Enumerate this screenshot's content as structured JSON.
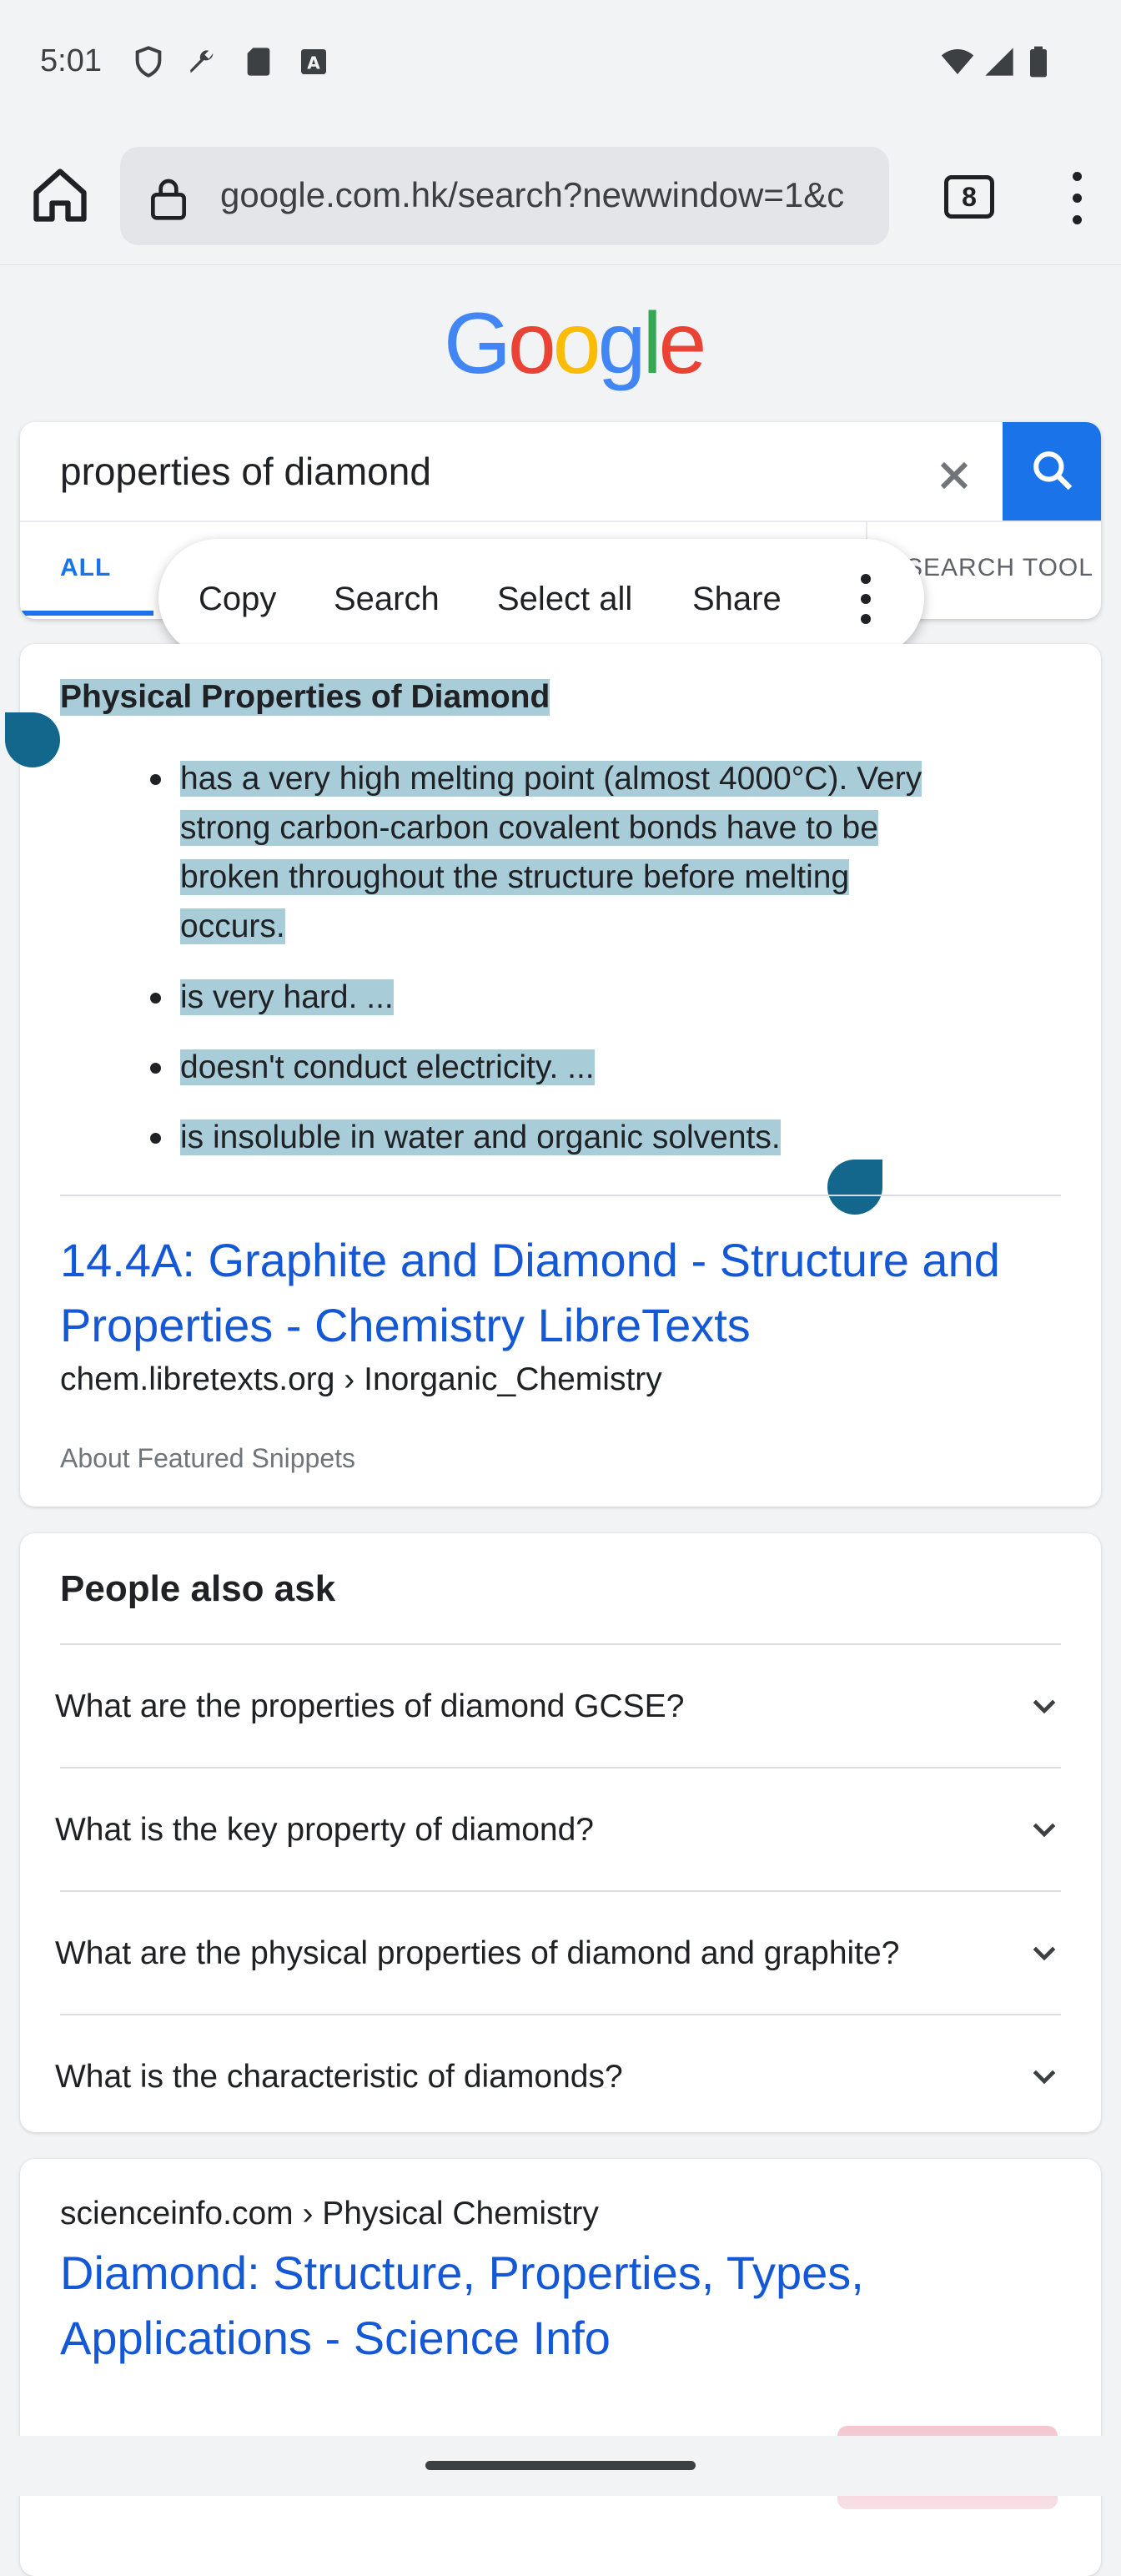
{
  "status_bar": {
    "time": "5:01"
  },
  "browser": {
    "url": "google.com.hk/search?newwindow=1&c",
    "tab_count": "8"
  },
  "logo": {
    "text": "Google"
  },
  "search": {
    "query": "properties of diamond",
    "tabs": {
      "all": "ALL",
      "tools": "SEARCH TOOL"
    }
  },
  "context_menu": {
    "copy": "Copy",
    "search": "Search",
    "select_all": "Select all",
    "share": "Share"
  },
  "snippet": {
    "heading": "Physical Properties of Diamond",
    "bullets": [
      [
        "has a very high melting point (almost 4000°C). Very",
        "strong carbon-carbon covalent bonds have to be",
        "broken throughout the structure before melting",
        "occurs."
      ],
      "is very hard. ...",
      "doesn't conduct electricity. ...",
      "is insoluble in water and organic solvents."
    ],
    "result_title": "14.4A: Graphite and Diamond - Structure and Properties - Chemistry LibreTexts",
    "result_cite": "chem.libretexts.org › Inorganic_Chemistry",
    "about": "About Featured Snippets"
  },
  "people_also_ask": {
    "title": "People also ask",
    "questions": [
      "What are the properties of diamond GCSE?",
      "What is the key property of diamond?",
      "What are the physical properties of diamond and graphite?",
      "What is the characteristic of diamonds?"
    ]
  },
  "result2": {
    "cite": "scienceinfo.com › Physical Chemistry",
    "title": "Diamond: Structure, Properties, Types, Applications - Science Info"
  },
  "colors": {
    "accent": "#1a73e8",
    "link": "#1558d6",
    "selection": "#a8cdd9",
    "handle": "#13678c"
  }
}
